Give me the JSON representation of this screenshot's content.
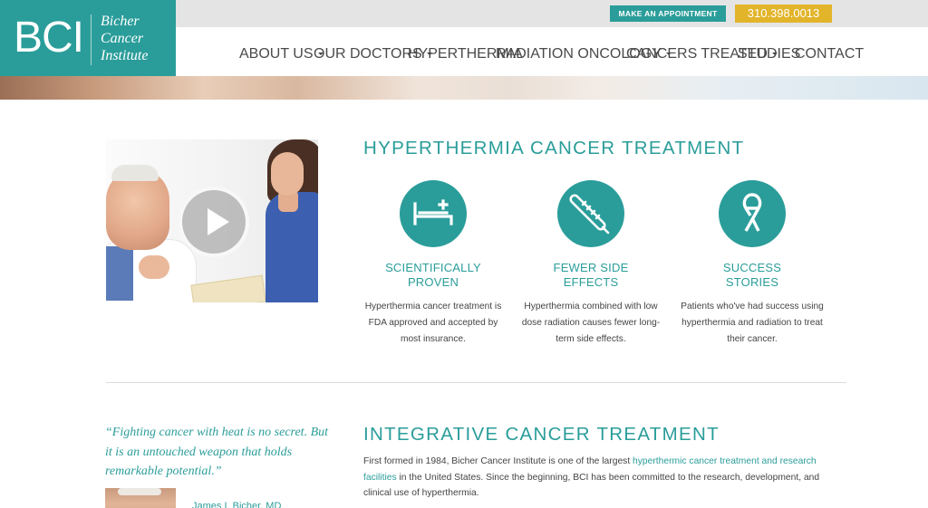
{
  "brand": {
    "logo_mark": "BCI",
    "logo_name_line1": "Bicher",
    "logo_name_line2": "Cancer",
    "logo_name_line3": "Institute",
    "primary_color": "#2a9d9a",
    "accent_color": "#e2b42a"
  },
  "topbar": {
    "appointment_label": "MAKE AN APPOINTMENT",
    "phone": "310.398.0013"
  },
  "nav": {
    "items": [
      {
        "label": "ABOUT US",
        "dropdown": true
      },
      {
        "label": "OUR DOCTORS",
        "dropdown": true
      },
      {
        "label": "HYPERTHERMIA",
        "dropdown": false
      },
      {
        "label": "RADIATION ONCOLOGY",
        "dropdown": true
      },
      {
        "label": "CANCERS TREATED",
        "dropdown": true
      },
      {
        "label": "STUDIES",
        "dropdown": false
      },
      {
        "label": "CONTACT",
        "dropdown": false
      }
    ]
  },
  "video": {
    "icon": "play-icon"
  },
  "section1": {
    "heading": "HYPERTHERMIA CANCER TREATMENT",
    "features": [
      {
        "icon": "hospital-bed-icon",
        "title_line1": "SCIENTIFICALLY",
        "title_line2": "PROVEN",
        "text": "Hyperthermia cancer treatment is FDA approved and accepted by most insurance."
      },
      {
        "icon": "thermometer-icon",
        "title_line1": "FEWER SIDE",
        "title_line2": "EFFECTS",
        "text": "Hyperthermia combined with low dose radiation causes fewer long-term side effects."
      },
      {
        "icon": "awareness-ribbon-icon",
        "title_line1": "SUCCESS",
        "title_line2": "STORIES",
        "text": "Patients who've had success using hyperthermia and radiation to treat their cancer."
      }
    ]
  },
  "section2": {
    "quote": "“Fighting cancer with heat is no secret. But it is an untouched weapon that holds remarkable potential.”",
    "quote_author": "James I. Bicher, MD",
    "heading": "INTEGRATIVE CANCER TREATMENT",
    "para_before": "First formed in 1984, Bicher Cancer Institute is one of the largest ",
    "para_link": "hyperthermic cancer treatment and research facilities",
    "para_after": " in the United States. Since the beginning, BCI has been committed to the research, development, and clinical use of hyperthermia."
  }
}
